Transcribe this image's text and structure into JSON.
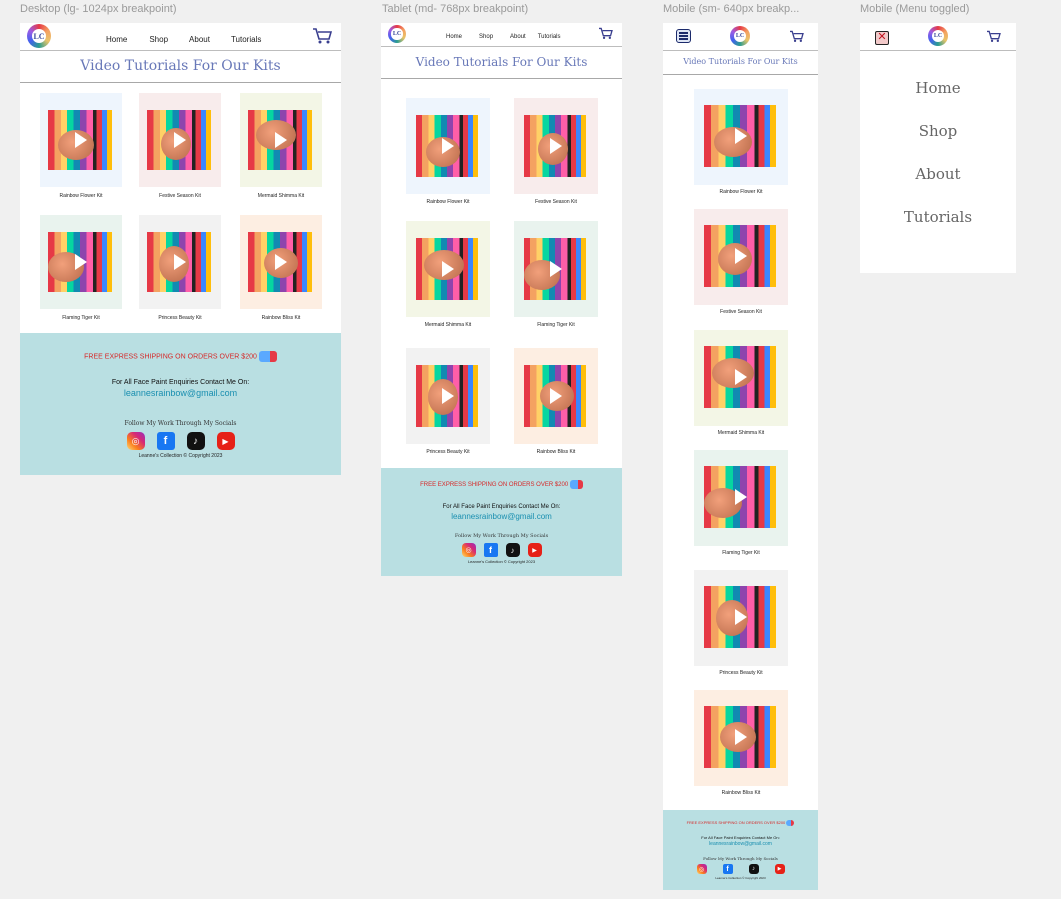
{
  "labels": {
    "desktop": "Desktop (lg- 1024px breakpoint)",
    "tablet": "Tablet (md- 768px breakpoint)",
    "mobile": "Mobile (sm- 640px breakp...",
    "menu": "Mobile (Menu toggled)"
  },
  "logo_text": "LC",
  "nav": [
    "Home",
    "Shop",
    "About",
    "Tutorials"
  ],
  "title": "Video Tutorials For Our Kits",
  "kits": [
    {
      "label": "Rainbow Flower Kit",
      "bg": "#eef5fd"
    },
    {
      "label": "Festive Season Kit",
      "bg": "#f8ecec"
    },
    {
      "label": "Mermaid Shimma Kit",
      "bg": "#f3f6e6"
    },
    {
      "label": "Flaming Tiger Kit",
      "bg": "#e9f3ee"
    },
    {
      "label": "Princess Beauty Kit",
      "bg": "#f2f2f2"
    },
    {
      "label": "Rainbow Bliss Kit",
      "bg": "#fdeee2"
    }
  ],
  "footer": {
    "shipping": "FREE EXPRESS SHIPPING ON ORDERS OVER $200",
    "enquiry": "For All Face Paint Enquiries Contact Me On:",
    "email": "leannesrainbow@gmail.com",
    "follow": "Follow My Work Through My Socials",
    "copyright": "Leanne's Collection © Copyright 2023"
  },
  "socials": [
    "instagram-icon",
    "facebook-icon",
    "tiktok-icon",
    "youtube-icon"
  ],
  "menu_items": [
    "Home",
    "Shop",
    "About",
    "Tutorials"
  ],
  "colors": {
    "footer_bg": "#b9dfe2",
    "title": "#6878b8",
    "shipping": "#d62828",
    "email": "#1a8fb0"
  }
}
